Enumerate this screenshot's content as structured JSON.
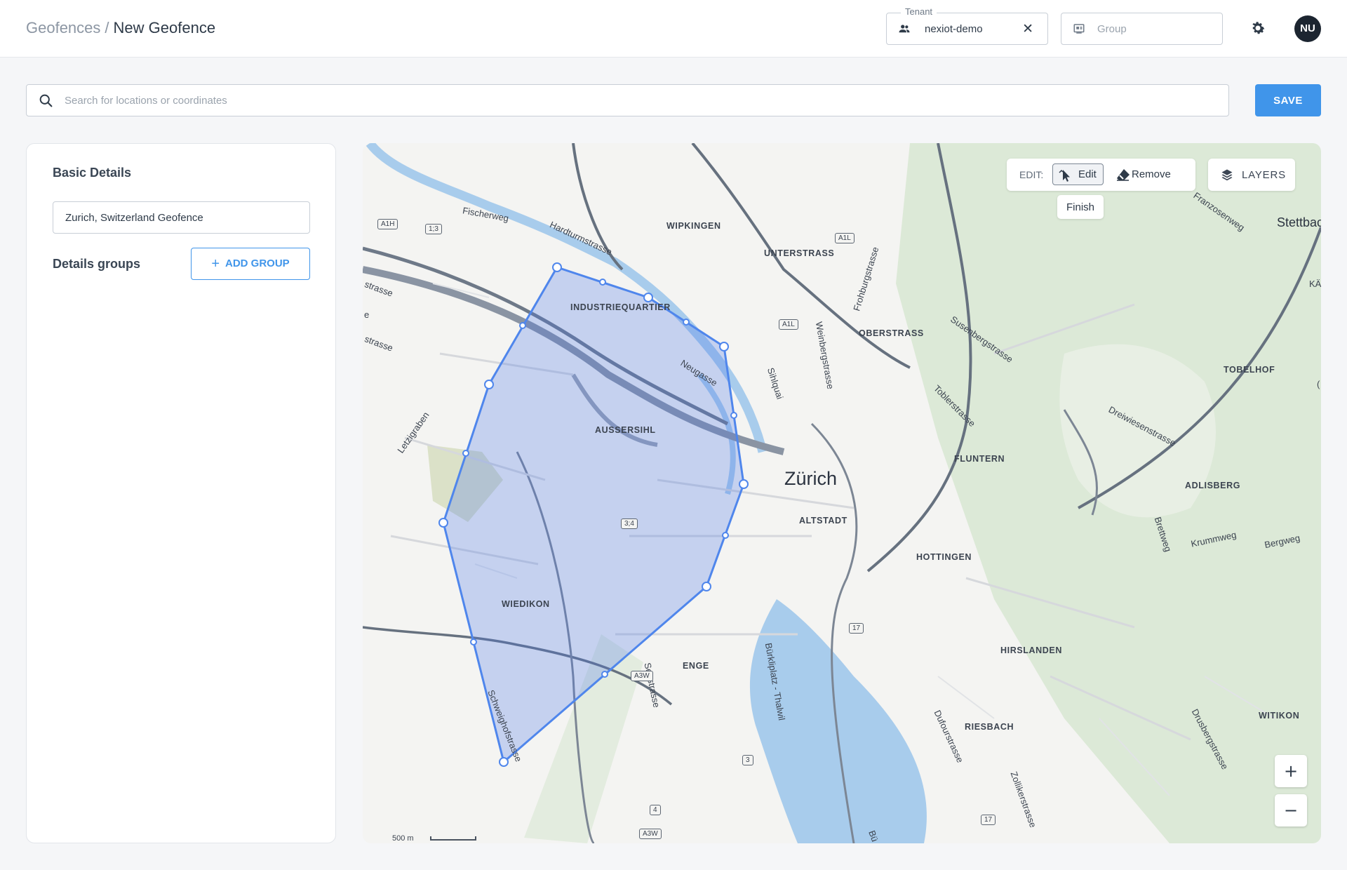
{
  "header": {
    "breadcrumb_root": "Geofences",
    "breadcrumb_sep": "/",
    "breadcrumb_current": "New Geofence",
    "tenant": {
      "legend": "Tenant",
      "value": "nexiot-demo",
      "clear": "✕",
      "icon": "users-icon"
    },
    "group": {
      "placeholder": "Group",
      "icon": "group-icon"
    },
    "settings_icon": "gear-icon",
    "avatar_initials": "NU"
  },
  "search": {
    "placeholder": "Search for locations or coordinates",
    "value": ""
  },
  "save_label": "SAVE",
  "panel": {
    "title": "Basic Details",
    "name_value": "Zurich, Switzerland Geofence",
    "details_groups_label": "Details groups",
    "add_group_label": "ADD GROUP"
  },
  "map": {
    "edit_label": "EDIT:",
    "edit_button": "Edit",
    "remove_button": "Remove",
    "finish_button": "Finish",
    "layers_button": "LAYERS",
    "zoom_in": "+",
    "zoom_out": "−",
    "scale_label": "500 m",
    "city": "Zürich",
    "districts": [
      "WIPKINGEN",
      "UNTERSTRASS",
      "INDUSTRIEQUARTIER",
      "OBERSTRASS",
      "AUSSERSIHL",
      "FLUNTERN",
      "ALTSTADT",
      "HOTTINGEN",
      "WIEDIKON",
      "ENGE",
      "HIRSLANDEN",
      "RIESBACH",
      "TOBELHOF",
      "ADLISBERG",
      "WITIKON"
    ],
    "streets": [
      "Fischerweg",
      "Hardturmstrasse",
      "Neugasse",
      "Sihlquai",
      "Weinbergstrasse",
      "Frohburgstrasse",
      "Susenbergstrasse",
      "Toblerstrasse",
      "Letzigraben",
      "Dreiwiesenstrasse",
      "Franzosenweg",
      "Krummweg",
      "Bergweg",
      "Brettweg",
      "Seestrasse",
      "Bürkliplatz - Thalwil",
      "Dufourstrasse",
      "Schweighofstrasse",
      "Drusbergstrasse",
      "Zollikerstrasse",
      "strasse",
      "e",
      "strasse"
    ],
    "edge_places": [
      "Stettbac",
      "KÄ",
      "(",
      "Bü"
    ],
    "road_shields": [
      "A1H",
      "1;3",
      "A1L",
      "A1L",
      "3;4",
      "17",
      "A3W",
      "3",
      "4",
      "A3W",
      "17"
    ],
    "colors": {
      "fill": "#4a78e8",
      "stroke": "#4f86ec",
      "water": "#a8ccec",
      "park": "#d7e6d1"
    }
  }
}
